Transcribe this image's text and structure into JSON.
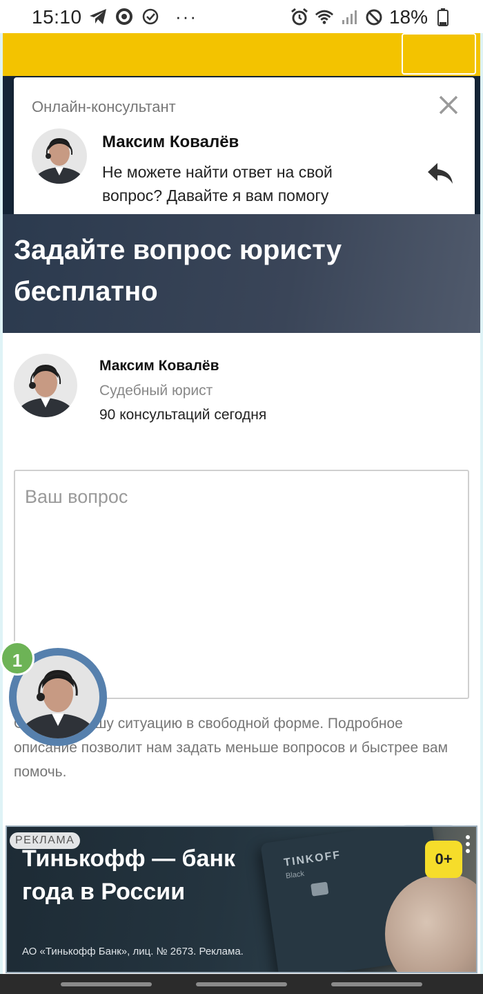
{
  "status_bar": {
    "time": "15:10",
    "battery": "18%",
    "icons": [
      "telegram-icon",
      "sync-icon",
      "check-circle-icon",
      "more-dots-icon",
      "alarm-icon",
      "wifi-icon",
      "signal-icon",
      "do-not-disturb-icon",
      "battery-icon"
    ],
    "dots": "···"
  },
  "chat_popup": {
    "title": "Онлайн-консультант",
    "name": "Максим Ковалёв",
    "message": "Не можете найти ответ на свой вопрос? Давайте я вам помогу"
  },
  "hero": {
    "title": "Задайте вопрос юристу бесплатно"
  },
  "lawyer": {
    "name": "Максим Ковалёв",
    "role": "Судебный юрист",
    "consultations": "90 консультаций сегодня"
  },
  "question": {
    "placeholder": "Ваш вопрос",
    "value": ""
  },
  "hint": "Опишите вашу ситуацию в свободной форме. Подробное описание позволит нам задать меньше вопросов и быстрее вам помочь.",
  "floating_chat": {
    "badge": "1"
  },
  "ad": {
    "label": "РЕКЛАМА",
    "headline": "Тинькофф — банк года в России",
    "disclaimer": "АО «Тинькофф Банк», лиц. № 2673. Реклама.",
    "card_brand": "TINKOFF",
    "card_sub": "Black",
    "age_rating": "0+"
  },
  "colors": {
    "accent_yellow": "#f3c300",
    "header_dark": "#152537",
    "badge_green": "#6db356",
    "avatar_ring": "#5680ad"
  }
}
